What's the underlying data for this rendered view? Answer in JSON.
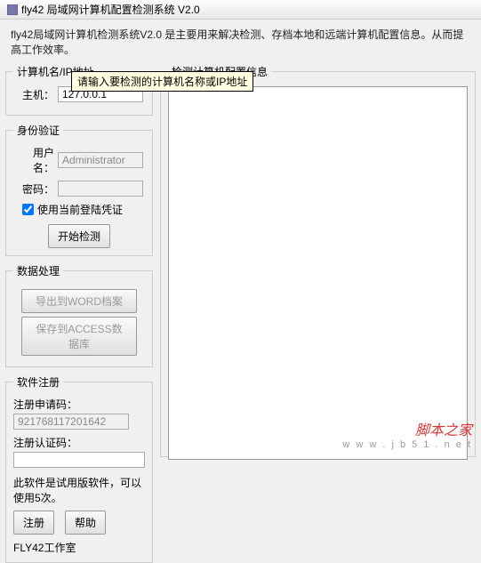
{
  "window": {
    "title": "fly42 局域网计算机配置检测系统 V2.0"
  },
  "intro": "fly42局域网计算机检测系统V2.0 是主要用来解决检测、存档本地和远端计算机配置信息。从而提高工作效率。",
  "host_group": {
    "legend": "计算机名/IP地址",
    "host_label": "主机：",
    "host_value": "127.0.0.1",
    "tooltip": "请输入要检测的计算机名称或IP地址"
  },
  "auth": {
    "legend": "身份验证",
    "user_label": "用户名：",
    "user_value": "Administrator",
    "pass_label": "密码：",
    "pass_value": "",
    "use_current": "使用当前登陆凭证",
    "start_btn": "开始检测"
  },
  "data_proc": {
    "legend": "数据处理",
    "export_word": "导出到WORD档案",
    "save_access": "保存到ACCESS数据库"
  },
  "register": {
    "legend": "软件注册",
    "apply_code_label": "注册申请码：",
    "apply_code_value": "921768117201642",
    "verify_code_label": "注册认证码：",
    "verify_code_value": "",
    "note": "此软件是试用版软件，可以使用5次。",
    "register_btn": "注册",
    "help_btn": "帮助",
    "studio": "FLY42工作室"
  },
  "result": {
    "legend": "检测计算机配置信息"
  },
  "watermark": {
    "text": "脚本之家",
    "url": "w w w . j b 5 1 . n e t"
  }
}
